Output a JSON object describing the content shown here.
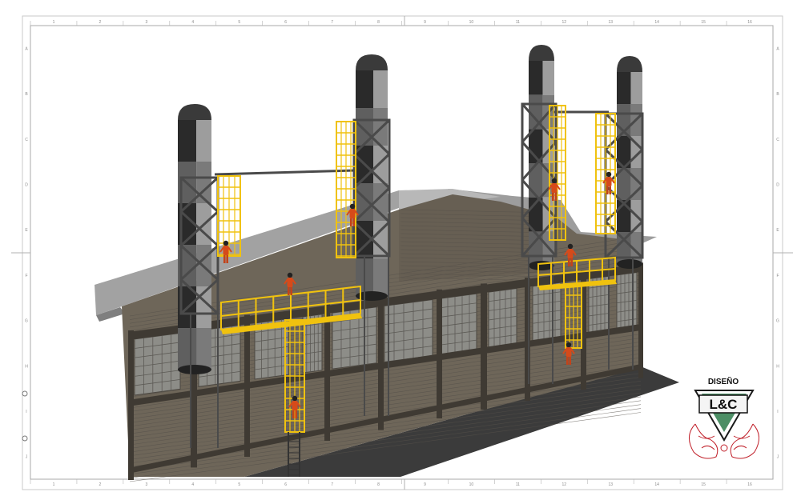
{
  "sheet": {
    "background": "#ffffff",
    "frame_color": "#b9b9b9",
    "tick_label_color": "#8a8a8a"
  },
  "ruler_top": [
    "1",
    "2",
    "3",
    "4",
    "5",
    "6",
    "7",
    "8",
    "9",
    "10",
    "11",
    "12",
    "13",
    "14",
    "15",
    "16"
  ],
  "ruler_bottom": [
    "1",
    "2",
    "3",
    "4",
    "5",
    "6",
    "7",
    "8",
    "9",
    "10",
    "11",
    "12",
    "13",
    "14",
    "15",
    "16"
  ],
  "ruler_left": [
    "A",
    "B",
    "C",
    "D",
    "E",
    "F",
    "G",
    "H",
    "I",
    "J"
  ],
  "ruler_right": [
    "A",
    "B",
    "C",
    "D",
    "E",
    "F",
    "G",
    "H",
    "I",
    "J"
  ],
  "colors": {
    "wall": "#6e6659",
    "wall_dark": "#463f36",
    "window": "#8c8c88",
    "roof": "#9a9a9a",
    "roof_light": "#b4b4b4",
    "ground_shadow": "#3a3a3a",
    "stack_dark": "#262626",
    "stack_mid": "#5b5b5b",
    "stack_light": "#9c9c9c",
    "frame_steel": "#4d4d4d",
    "cage_yellow": "#f2c40f",
    "worker_orange": "#d84a1a",
    "logo_red": "#c0202a"
  },
  "logo": {
    "top_text": "DISEÑO",
    "main_text": "L&C"
  }
}
